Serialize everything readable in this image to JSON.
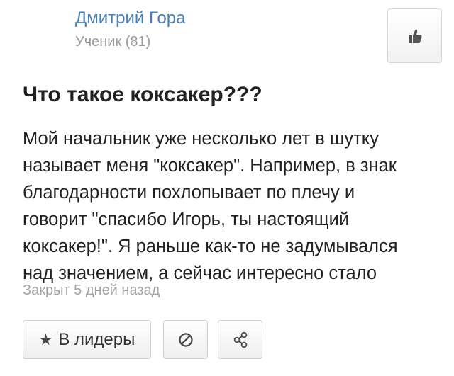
{
  "author": {
    "name": "Дмитрий Гора",
    "rank": "Ученик (81)"
  },
  "question": {
    "title": "Что такое коксакер???",
    "body_lines": [
      "Мой начальник уже несколько лет в шутку",
      "называет меня \"коксакер\". Например, в знак",
      "благодарности похлопывает по плечу и",
      "говорит \"спасибо Игорь, ты настоящий",
      "коксакер!\". Я раньше как-то не задумывался",
      "над значением, а сейчас интересно стало"
    ],
    "status": "Закрыт 5 дней назад"
  },
  "actions": {
    "leaders_label": "В лидеры",
    "leaders_icon": "star-icon",
    "block_icon": "block-icon",
    "share_icon": "share-icon",
    "like_icon": "thumbs-up-icon"
  },
  "colors": {
    "author_link": "#4a7fb6",
    "muted_text": "#9a9a9a",
    "title_text": "#222222",
    "button_border": "#cfcfcf"
  }
}
